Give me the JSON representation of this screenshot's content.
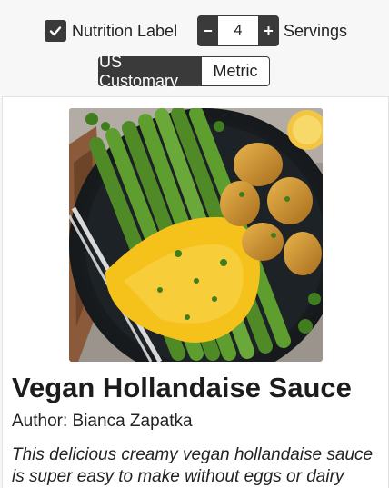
{
  "controls": {
    "nutrition_label": "Nutrition Label",
    "nutrition_checked": true,
    "minus_label": "−",
    "plus_label": "+",
    "servings_value": "4",
    "servings_label": "Servings",
    "units": {
      "us_label": "US Customary",
      "metric_label": "Metric",
      "selected": "US Customary"
    }
  },
  "colors": {
    "control_dark": "#3a3a3a",
    "sauce": "#f5c21b",
    "asparagus": "#5e9e2f"
  },
  "recipe": {
    "title": "Vegan Hollandaise Sauce",
    "author": "Author: Bianca Zapatka",
    "description": "This delicious creamy vegan hollandaise sauce is super easy to make without eggs or dairy"
  }
}
